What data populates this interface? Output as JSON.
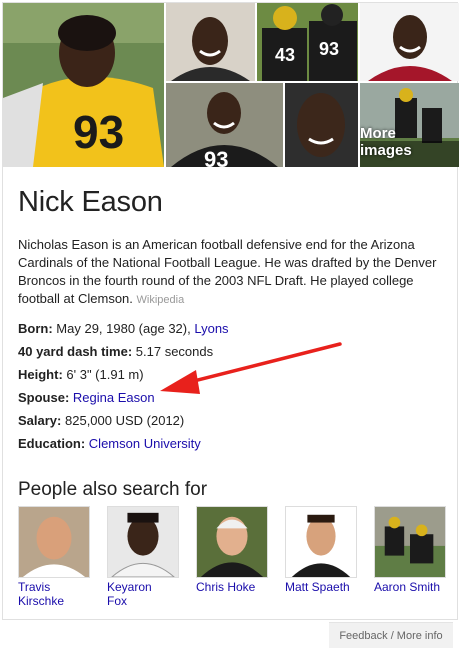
{
  "colors": {
    "link": "#1a0dab",
    "text": "#222222",
    "source": "#999999",
    "arrow": "#e8211c",
    "jersey_gold": "#f2c21b",
    "jersey_black": "#1b1b1b",
    "jersey_red": "#a5162a"
  },
  "mosaic": {
    "more_images_label": "More images"
  },
  "entity": {
    "title": "Nick Eason",
    "description": "Nicholas Eason is an American football defensive end for the Arizona Cardinals of the National Football League. He was drafted by the Denver Broncos in the fourth round of the 2003 NFL Draft. He played college football at Clemson.",
    "source": "Wikipedia"
  },
  "facts": {
    "born_label": "Born:",
    "born_value": "May 29, 1980 (age 32),",
    "born_place": "Lyons",
    "dash_label": "40 yard dash time:",
    "dash_value": "5.17 seconds",
    "height_label": "Height:",
    "height_value": "6' 3\" (1.91 m)",
    "spouse_label": "Spouse:",
    "spouse_value": "Regina Eason",
    "salary_label": "Salary:",
    "salary_value": "825,000 USD (2012)",
    "education_label": "Education:",
    "education_value": "Clemson University"
  },
  "people_also_search": {
    "title": "People also search for",
    "people": [
      {
        "name_line1": "Travis",
        "name_line2": "Kirschke"
      },
      {
        "name_line1": "Keyaron",
        "name_line2": "Fox"
      },
      {
        "name_line1": "Chris Hoke",
        "name_line2": ""
      },
      {
        "name_line1": "Matt Spaeth",
        "name_line2": ""
      },
      {
        "name_line1": "Aaron Smith",
        "name_line2": ""
      }
    ]
  },
  "footer": {
    "feedback_label": "Feedback / More info"
  }
}
